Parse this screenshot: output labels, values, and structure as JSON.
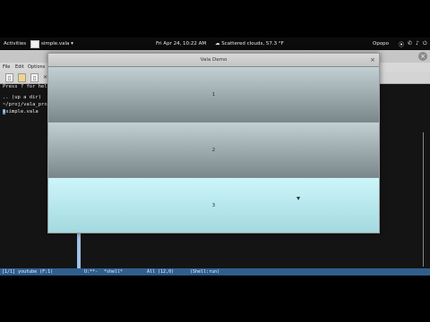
{
  "topbar": {
    "activities": "Activities",
    "app_name": "simple.vala ▾",
    "clock": "Fri Apr 24, 10:22 AM",
    "weather": "☁ Scattered clouds, 57.3 °F",
    "user": "Opopo",
    "tray": [
      "⦿",
      "✆",
      "♪",
      "⏻"
    ]
  },
  "emacs": {
    "menu": [
      "File",
      "Edit",
      "Options"
    ],
    "toolbar_icons": [
      "new-file-icon",
      "open-folder-icon",
      "save-icon",
      "close-icon"
    ],
    "lines": [
      "Press ? for help",
      ".. (up a dir)",
      "~/proj/vala_proj",
      "simple.vala"
    ],
    "modeline": {
      "left": "[1/1] youtube (F:1)",
      "status": "U:**-",
      "buffer": "*shell*",
      "position": "All (12,0)",
      "mode": "(Shell:run)"
    }
  },
  "demo": {
    "title": "Vala Demo",
    "buttons": [
      "1",
      "2",
      "3"
    ]
  }
}
